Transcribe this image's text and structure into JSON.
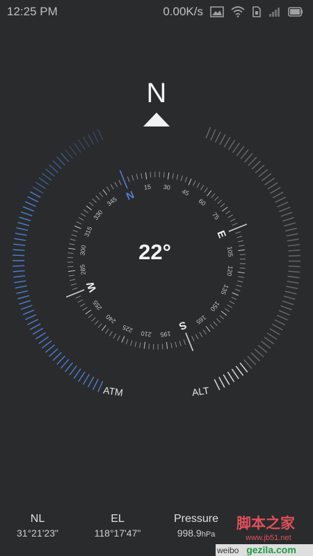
{
  "status_bar": {
    "time": "12:25 PM",
    "network_speed": "0.00K/s",
    "icons": [
      "image-icon",
      "wifi-icon",
      "sim-icon",
      "signal-icon",
      "battery-icon"
    ]
  },
  "compass": {
    "north_label": "N",
    "heading": "22°",
    "heading_degrees": 22,
    "cardinals": {
      "n": "N",
      "e": "E",
      "s": "S",
      "w": "W"
    },
    "dial_numbers": [
      "15",
      "30",
      "45",
      "60",
      "75",
      "105",
      "120",
      "135",
      "150",
      "165",
      "195",
      "210",
      "225",
      "240",
      "255",
      "285",
      "300",
      "315",
      "330",
      "345"
    ],
    "atm_label": "ATM",
    "alt_label": "ALT",
    "accent_color": "#4f7fd0"
  },
  "location": {
    "lat_label": "NL",
    "lat_value": "31°21'23\"",
    "lon_label": "EL",
    "lon_value": "118°17'47\"",
    "pressure_label": "Pressure",
    "pressure_value": "998.9",
    "pressure_unit": "hPa"
  },
  "watermark": {
    "site_cn": "脚本之家",
    "site_url": "www.jb51.net",
    "site2": "gezila.com",
    "weibo": "weibo"
  }
}
